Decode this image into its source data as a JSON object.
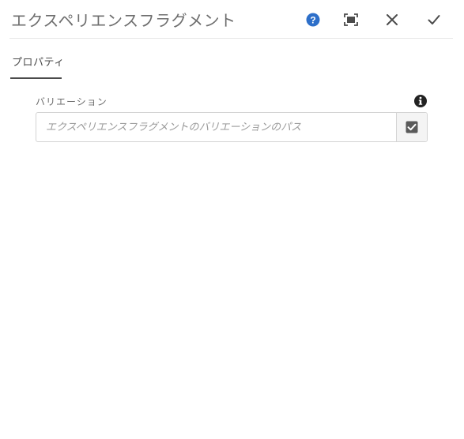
{
  "dialog": {
    "title": "エクスペリエンスフラグメント",
    "help_icon": "help-icon",
    "fullscreen_icon": "fullscreen-icon",
    "close_icon": "close-icon",
    "done_icon": "checkmark-icon"
  },
  "tabs": [
    {
      "label": "プロパティ",
      "active": true
    }
  ],
  "fields": {
    "variation": {
      "label": "バリエーション",
      "value": "",
      "placeholder": "エクスペリエンスフラグメントのバリエーションのパス",
      "info_icon": "info-icon",
      "picker_icon": "checkbox-picker-icon"
    }
  },
  "colors": {
    "help_blue": "#2d6fc9",
    "icon_dark": "#4b4b4b",
    "picker_icon": "#5a5a5a"
  }
}
